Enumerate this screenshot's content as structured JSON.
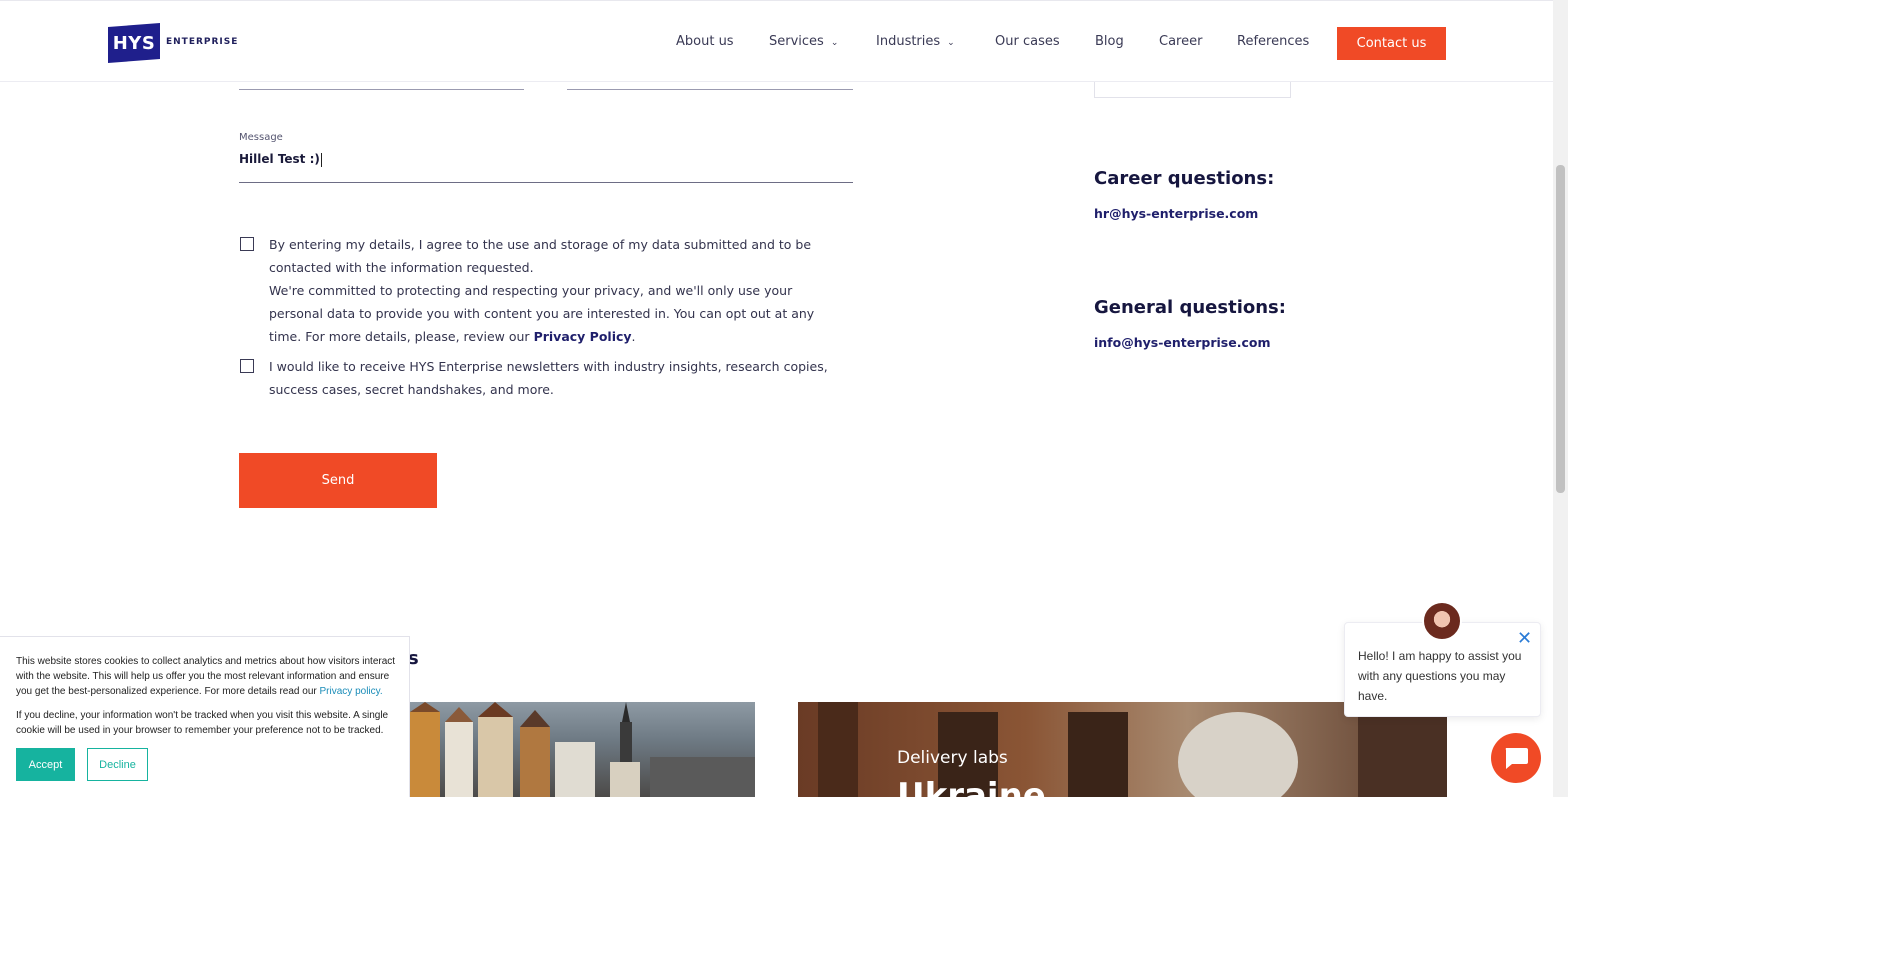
{
  "header": {
    "logo_mark": "HYS",
    "logo_text": "ENTERPRISE",
    "nav": [
      {
        "label": "About us"
      },
      {
        "label": "Services"
      },
      {
        "label": "Industries"
      },
      {
        "label": "Our cases"
      },
      {
        "label": "Blog"
      },
      {
        "label": "Career"
      },
      {
        "label": "References"
      }
    ],
    "cta": "Contact us"
  },
  "form": {
    "message_label": "Message",
    "message_value": "Hillel Test :)",
    "consent_text_1": "By entering my details, I agree to the use and storage of my data submitted and to be contacted with the information requested.",
    "consent_text_2": "We're committed to protecting and respecting your privacy, and we'll only use your personal data to provide you with content you are interested in. You can opt out at any time. For more details, please, review our",
    "privacy_link": "Privacy Policy",
    "newsletter_text": "I would like to receive HYS Enterprise newsletters with industry insights, research copies, success cases, secret handshakes, and more.",
    "send": "Send"
  },
  "right": {
    "career_heading": "Career questions:",
    "career_email": "hr@hys-enterprise.com",
    "general_heading": "General questions:",
    "general_email": "info@hys-enterprise.com"
  },
  "bottom": {
    "partial_title": "s",
    "card_label": "Delivery labs",
    "card_title": "Ukraine"
  },
  "cookie": {
    "text1": "This website stores cookies to collect analytics and metrics about how visitors interact with the website. This will help us offer you the most relevant information and ensure you get the best-personalized experience. For more details read our",
    "link": "Privacy policy.",
    "text2": "If you decline, your information won't be tracked when you visit this website. A single cookie will be used in your browser to remember your preference not to be tracked.",
    "accept": "Accept",
    "decline": "Decline"
  },
  "chat": {
    "message": "Hello! I am happy to assist you with any questions you may have."
  },
  "colors": {
    "accent": "#f04a26",
    "brand": "#1f1f8c",
    "cookie_accent": "#16b39f"
  }
}
